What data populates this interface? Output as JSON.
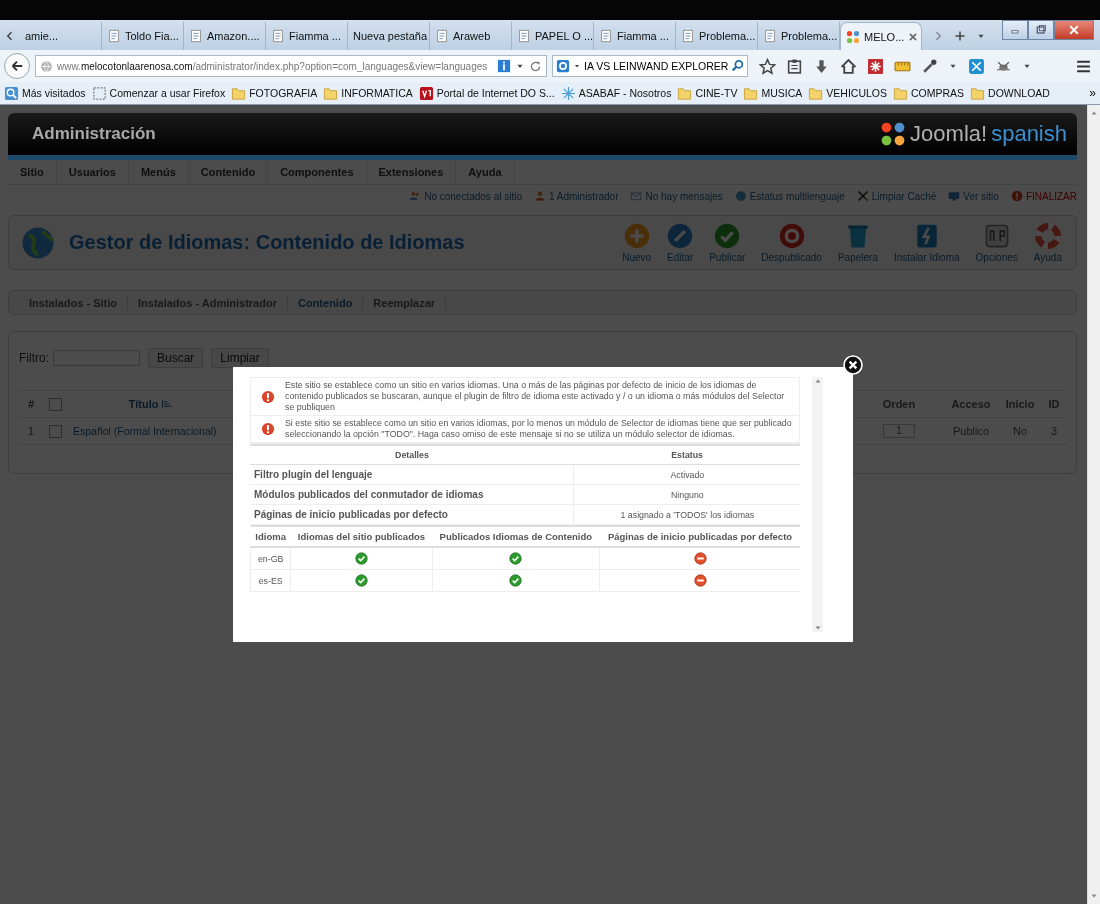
{
  "browser": {
    "tabs": [
      {
        "label": "amie...",
        "selected": false,
        "favicon": false
      },
      {
        "label": "Toldo Fia...",
        "selected": false,
        "favicon": true
      },
      {
        "label": "Amazon....",
        "selected": false,
        "favicon": true
      },
      {
        "label": "Fiamma ...",
        "selected": false,
        "favicon": true
      },
      {
        "label": "Nueva pestaña",
        "selected": false,
        "favicon": false
      },
      {
        "label": "Araweb",
        "selected": false,
        "favicon": true
      },
      {
        "label": "PAPEL O ...",
        "selected": false,
        "favicon": true
      },
      {
        "label": "Fiamma ...",
        "selected": false,
        "favicon": true
      },
      {
        "label": "Problema...",
        "selected": false,
        "favicon": true
      },
      {
        "label": "Problema...",
        "selected": false,
        "favicon": true
      },
      {
        "label": "MELO...",
        "selected": true,
        "favicon": true
      }
    ],
    "address": {
      "value": "www.**melocotonlaarenosa.com**/administrator/index.php?option=com_languages&view=languages"
    },
    "search": {
      "value": "IA VS LEINWAND EXPLORER"
    },
    "bookmarks": [
      {
        "label": "Más visitados",
        "kind": "history"
      },
      {
        "label": "Comenzar a usar Firefox",
        "kind": "page"
      },
      {
        "label": "FOTOGRAFIA",
        "kind": "folder"
      },
      {
        "label": "INFORMATICA",
        "kind": "folder"
      },
      {
        "label": "Portal de Internet DO S...",
        "kind": "site"
      },
      {
        "label": "ASABAF - Nosotros",
        "kind": "star"
      },
      {
        "label": "CINE-TV",
        "kind": "folder"
      },
      {
        "label": "MUSICA",
        "kind": "folder"
      },
      {
        "label": "VEHICULOS",
        "kind": "folder"
      },
      {
        "label": "COMPRAS",
        "kind": "folder"
      },
      {
        "label": "DOWNLOAD",
        "kind": "folder"
      }
    ],
    "bookmarks_more": "»"
  },
  "admin": {
    "title": "Administración",
    "logo": {
      "name": "Joomla!",
      "suffix": "spanish"
    },
    "menu": [
      "Sitio",
      "Usuarios",
      "Menús",
      "Contenido",
      "Componentes",
      "Extensiones",
      "Ayuda"
    ],
    "status": [
      {
        "label": "No conectados al sitio",
        "kind": "users"
      },
      {
        "label": "1 Administrador",
        "kind": "user"
      },
      {
        "label": "No hay mensajes",
        "kind": "mail"
      },
      {
        "label": "Estatus multilenguaje",
        "kind": "globe"
      },
      {
        "label": "Limpiar Caché",
        "kind": "broom"
      },
      {
        "label": "Ver sitio",
        "kind": "monitor"
      },
      {
        "label": "FINALIZAR",
        "kind": "alert"
      }
    ],
    "page_title": "Gestor de Idiomas: Contenido de Idiomas",
    "toolbar": [
      {
        "label": "Nuevo",
        "kind": "new"
      },
      {
        "label": "Editar",
        "kind": "edit"
      },
      {
        "label": "Publicar",
        "kind": "publish"
      },
      {
        "label": "Despublicado",
        "kind": "unpublish"
      },
      {
        "label": "Papelera",
        "kind": "trash"
      },
      {
        "label": "Instalar Idioma",
        "kind": "install"
      },
      {
        "label": "Opciones",
        "kind": "options"
      },
      {
        "label": "Ayuda",
        "kind": "help"
      }
    ],
    "subtabs": [
      {
        "label": "Instalados - Sitio",
        "selected": false
      },
      {
        "label": "Instalados - Administrador",
        "selected": false
      },
      {
        "label": "Contenido",
        "selected": true
      },
      {
        "label": "Reemplazar",
        "selected": false
      }
    ],
    "filter": {
      "label": "Filtro:",
      "buttons": [
        "Buscar",
        "Limpiar"
      ]
    },
    "list": {
      "columns": [
        "#",
        "Título",
        "Orden",
        "Acceso",
        "Inicio",
        "ID"
      ],
      "select_all": false,
      "rows": [
        {
          "number": "1",
          "checked": false,
          "title": "Español (Formal Internacional)",
          "order": "1",
          "access": "Publico",
          "home": "No",
          "id": "3"
        }
      ]
    }
  },
  "modal": {
    "warnings": [
      "Este sitio se establece como un sitio en varios idiomas. Una o más de las páginas por defecto de inicio de los idiomas de contenido publicados se buscaran, aunque el plugin de filtro de idioma este activado y / o un idioma o más módulos del Selector se publiquen",
      "Si este sitio se establece como un sitio en varios idiomas, por lo menos un módulo de Selector de idiomas tiene que ser publicado seleccionando la opción \"TODO\". Haga caso omiso de este mensaje si no se utiliza un módulo selector de idiomas."
    ],
    "details": {
      "columns": [
        "Detalles",
        "Estatus"
      ],
      "rows": [
        {
          "label": "Filtro plugin del lenguaje",
          "value": "Activado"
        },
        {
          "label": "Módulos publicados del conmutador de idiomas",
          "value": "Ninguno"
        },
        {
          "label": "Páginas de inicio publicadas por defecto",
          "value": "1 asignado a 'TODOS' los idiomas"
        }
      ]
    },
    "languages": {
      "columns": [
        "Idioma",
        "Idiomas del sitio publicados",
        "Publicados Idiomas de Contenido",
        "Páginas de inicio publicadas por defecto"
      ],
      "rows": [
        {
          "code": "en-GB",
          "site_published": true,
          "content_published": true,
          "home_published": false
        },
        {
          "code": "es-ES",
          "site_published": true,
          "content_published": true,
          "home_published": false
        }
      ]
    }
  }
}
